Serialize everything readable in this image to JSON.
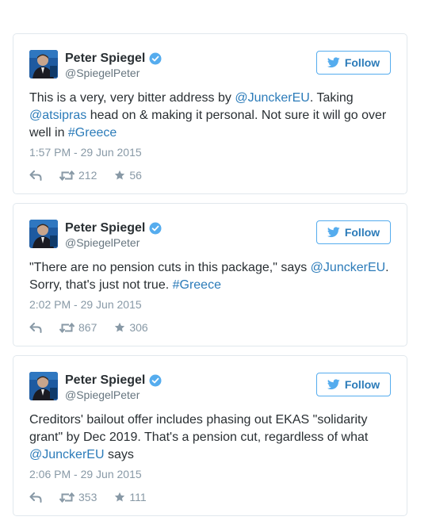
{
  "tweets": [
    {
      "name": "Peter Spiegel",
      "handle": "@SpiegelPeter",
      "follow_label": "Follow",
      "text": [
        {
          "t": "This is a very, very bitter address by ",
          "link": false
        },
        {
          "t": "@JunckerEU",
          "link": true
        },
        {
          "t": ". Taking ",
          "link": false
        },
        {
          "t": "@atsipras",
          "link": true
        },
        {
          "t": " head on & making it personal. Not sure it will go over well in ",
          "link": false
        },
        {
          "t": "#Greece",
          "link": true
        }
      ],
      "timestamp": "1:57 PM - 29 Jun 2015",
      "retweets": "212",
      "favorites": "56"
    },
    {
      "name": "Peter Spiegel",
      "handle": "@SpiegelPeter",
      "follow_label": "Follow",
      "text": [
        {
          "t": "\"There are no pension cuts in this package,\" says ",
          "link": false
        },
        {
          "t": "@JunckerEU",
          "link": true
        },
        {
          "t": ". Sorry, that's just not true. ",
          "link": false
        },
        {
          "t": "#Greece",
          "link": true
        }
      ],
      "timestamp": "2:02 PM - 29 Jun 2015",
      "retweets": "867",
      "favorites": "306"
    },
    {
      "name": "Peter Spiegel",
      "handle": "@SpiegelPeter",
      "follow_label": "Follow",
      "text": [
        {
          "t": "Creditors' bailout offer includes phasing out EKAS \"solidarity grant\" by Dec 2019. That's a pension cut, regardless of what ",
          "link": false
        },
        {
          "t": "@JunckerEU",
          "link": true
        },
        {
          "t": " says",
          "link": false
        }
      ],
      "timestamp": "2:06 PM - 29 Jun 2015",
      "retweets": "353",
      "favorites": "111"
    }
  ],
  "colors": {
    "link": "#2b7bb9",
    "verified": "#55acee",
    "muted": "#8899a6",
    "border": "#e1e8ed"
  },
  "icons": {
    "verified": "verified-badge-icon",
    "follow": "twitter-bird-icon",
    "reply": "reply-icon",
    "retweet": "retweet-icon",
    "favorite": "star-icon"
  }
}
